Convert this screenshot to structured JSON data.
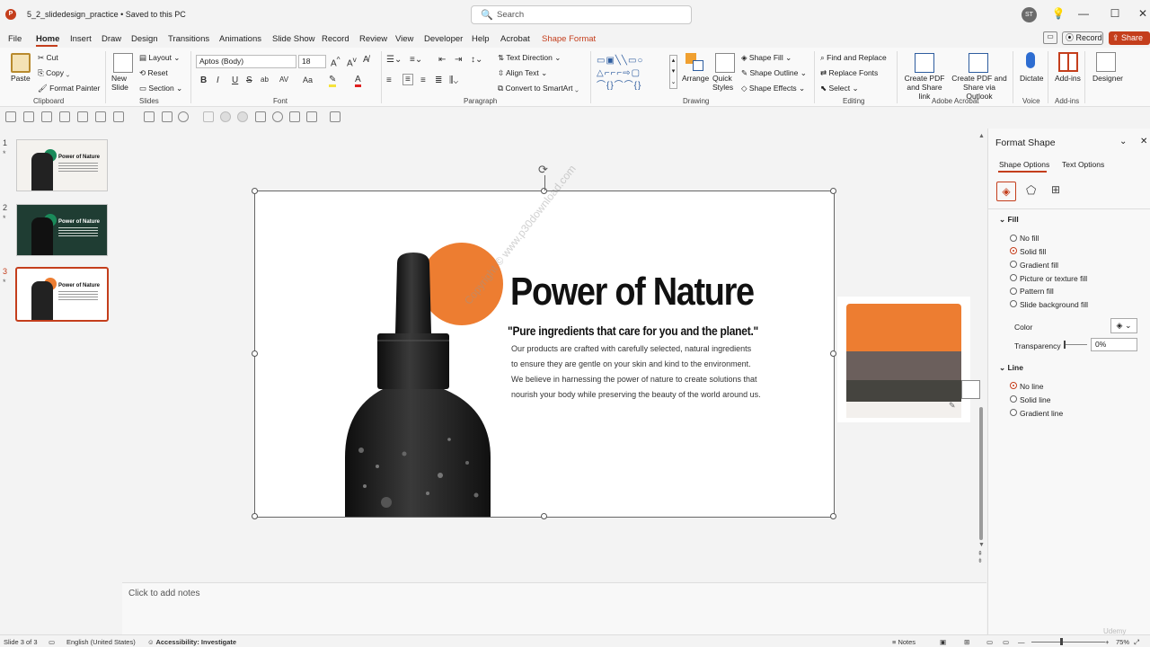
{
  "titlebar": {
    "app_icon": "P",
    "doc_title": "5_2_slidedesign_practice • Saved to this PC",
    "search_placeholder": "Search",
    "avatar_initials": "ST",
    "search_icon": "🔍",
    "idea_icon": "💡",
    "min_icon": "—",
    "max_icon": "☐",
    "close_icon": "✕"
  },
  "menu": {
    "tabs": [
      "File",
      "Home",
      "Insert",
      "Draw",
      "Design",
      "Transitions",
      "Animations",
      "Slide Show",
      "Record",
      "Review",
      "View",
      "Developer",
      "Help",
      "Acrobat",
      "Shape Format"
    ],
    "active": "Home",
    "record_label": "Record",
    "share_label": "Share"
  },
  "ribbon": {
    "clipboard": {
      "paste": "Paste",
      "cut": "Cut",
      "copy": "Copy",
      "format_painter": "Format Painter",
      "label": "Clipboard"
    },
    "slides": {
      "new_slide": "New Slide",
      "layout": "Layout",
      "reset": "Reset",
      "section": "Section",
      "label": "Slides"
    },
    "font": {
      "font_name": "Aptos (Body)",
      "font_size": "18",
      "bold": "B",
      "italic": "I",
      "underline": "U",
      "strike": "S",
      "shadow": "ab",
      "spacing": "AV",
      "case": "Aa",
      "label": "Font"
    },
    "paragraph": {
      "text_direction": "Text Direction",
      "align_text": "Align Text",
      "smartart": "Convert to SmartArt",
      "label": "Paragraph"
    },
    "drawing": {
      "arrange": "Arrange",
      "quick_styles": "Quick Styles",
      "shape_fill": "Shape Fill",
      "shape_outline": "Shape Outline",
      "shape_effects": "Shape Effects",
      "label": "Drawing"
    },
    "editing": {
      "find": "Find and Replace",
      "replace_fonts": "Replace Fonts",
      "select": "Select",
      "label": "Editing"
    },
    "acrobat": {
      "create_share": "Create PDF and Share link",
      "create_outlook": "Create PDF and Share via Outlook",
      "label": "Adobe Acrobat"
    },
    "voice": {
      "dictate": "Dictate",
      "label": "Voice"
    },
    "addins": {
      "addins": "Add-ins",
      "label": "Add-ins"
    },
    "designer": {
      "designer": "Designer"
    }
  },
  "thumbnails": [
    {
      "number": "1",
      "star": "*",
      "title": "Power of Nature",
      "bg": "#f4f2ee",
      "accent": "#1a8a5a",
      "title_color": "#111"
    },
    {
      "number": "2",
      "star": "*",
      "title": "Power of Nature",
      "bg": "#1f3d33",
      "accent": "#1a8a5a",
      "title_color": "#ffffff"
    },
    {
      "number": "3",
      "star": "*",
      "title": "Power of Nature",
      "bg": "#ffffff",
      "accent": "#ed7d31",
      "title_color": "#111"
    }
  ],
  "slide": {
    "title": "Power of Nature",
    "quote": "\"Pure ingredients that care for you and the planet.\"",
    "body": [
      "Our products are crafted with carefully selected, natural ingredients",
      "to ensure they are gentle on your skin and kind to the environment.",
      "We believe in harnessing the power of nature to create solutions that",
      "nourish your body while preserving the beauty of the world around us."
    ],
    "watermark": "Copyright © www.p30download.com",
    "accent_color": "#ed7d31"
  },
  "palette": {
    "colors": [
      "#ed7d31",
      "#6b5f5c",
      "#45443f",
      "#f3f0ed"
    ]
  },
  "notes": {
    "placeholder": "Click to add notes"
  },
  "format_pane": {
    "title": "Format Shape",
    "tabs": [
      "Shape Options",
      "Text Options"
    ],
    "fill_header": "Fill",
    "fill_options": [
      "No fill",
      "Solid fill",
      "Gradient fill",
      "Picture or texture fill",
      "Pattern fill",
      "Slide background fill"
    ],
    "fill_selected": "Solid fill",
    "color_label": "Color",
    "transparency_label": "Transparency",
    "transparency_value": "0%",
    "line_header": "Line",
    "line_options": [
      "No line",
      "Solid line",
      "Gradient line"
    ],
    "line_selected": "No line"
  },
  "statusbar": {
    "slide_info": "Slide 3 of 3",
    "language": "English (United States)",
    "accessibility": "Accessibility: Investigate",
    "notes": "Notes",
    "zoom": "75%",
    "watermark": "Udemy"
  }
}
